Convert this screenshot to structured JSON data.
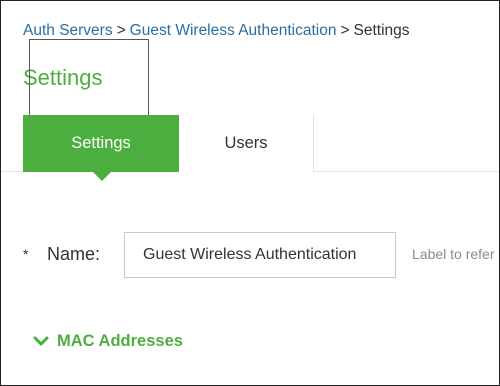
{
  "breadcrumb": {
    "items": [
      "Auth Servers",
      "Guest Wireless Authentication"
    ],
    "current": "Settings",
    "separator": ">"
  },
  "page": {
    "title": "Settings"
  },
  "tabs": [
    {
      "label": "Settings",
      "active": true
    },
    {
      "label": "Users",
      "active": false
    }
  ],
  "form": {
    "required_marker": "*",
    "name_label": "Name:",
    "name_value": "Guest Wireless Authentication",
    "name_help": "Label to refer to this server."
  },
  "sections": {
    "mac_addresses": {
      "label": "MAC Addresses",
      "expanded": true,
      "icon": "chevron-down-icon"
    }
  },
  "theme": {
    "accent": "#4cae3f",
    "link": "#2a6ea3"
  }
}
